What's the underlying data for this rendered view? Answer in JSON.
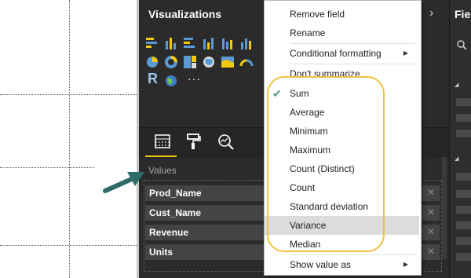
{
  "visualizations": {
    "title": "Visualizations",
    "expand_icon": "chevron-right-icon",
    "gallery_icons": [
      "stacked-bar-chart-icon",
      "stacked-column-chart-icon",
      "clustered-bar-chart-icon",
      "clustered-column-chart-icon",
      "line-chart-icon",
      "area-chart-icon",
      "pie-chart-icon",
      "donut-chart-icon",
      "treemap-icon",
      "map-icon",
      "filled-map-icon",
      "gauge-icon",
      "r-script-icon",
      "globe-icon",
      "more-visuals-icon"
    ],
    "tabs": [
      "fields-tab-icon",
      "format-paint-roller-icon",
      "analytics-magnifier-icon"
    ],
    "values_label": "Values",
    "fields": [
      "Prod_Name",
      "Cust_Name",
      "Revenue",
      "Units"
    ]
  },
  "fields_pane": {
    "title": "Fie"
  },
  "context_menu": {
    "items_top": [
      "Remove field",
      "Rename",
      "Conditional formatting",
      "Don't summarize"
    ],
    "aggregations": [
      "Sum",
      "Average",
      "Minimum",
      "Maximum",
      "Count (Distinct)",
      "Count",
      "Standard deviation",
      "Variance",
      "Median"
    ],
    "checked": "Sum",
    "highlighted": "Variance",
    "bottom_item": "Show value as"
  },
  "colors": {
    "pane_bg": "#2b2b2b",
    "accent": "#f2c811",
    "oval": "#f0c040",
    "pointer": "#2e6b6b"
  }
}
